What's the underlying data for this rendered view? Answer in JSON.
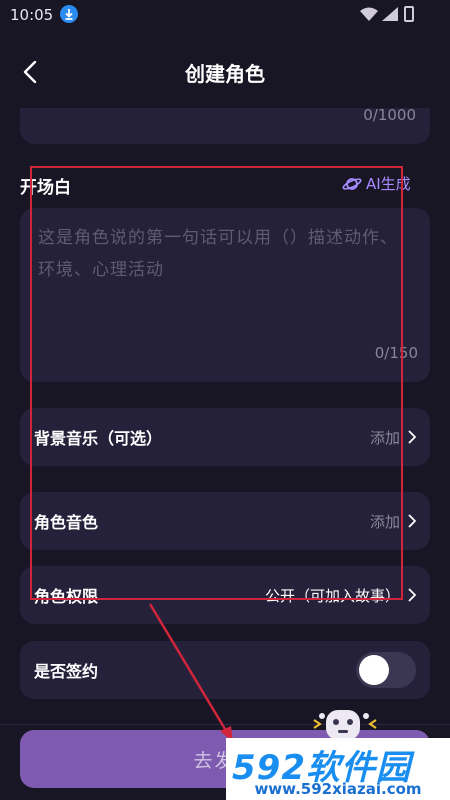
{
  "status_bar": {
    "time": "10:05",
    "icons": [
      "download-icon",
      "wifi-icon",
      "signal-icon",
      "battery-icon"
    ]
  },
  "header": {
    "title": "创建角色",
    "back_icon": "chevron-left-icon"
  },
  "description_card": {
    "counter": "0/1000"
  },
  "opening_line": {
    "label": "开场白",
    "ai_button": "AI生成",
    "ai_icon": "planet-icon",
    "placeholder": "这是角色说的第一句话可以用（）描述动作、环境、心理活动",
    "counter": "0/150"
  },
  "rows": {
    "music": {
      "label": "背景音乐（可选）",
      "value": "添加"
    },
    "voice": {
      "label": "角色音色",
      "value": "添加"
    },
    "permission": {
      "label": "角色权限",
      "value": "公开（可加入故事）"
    },
    "contract": {
      "label": "是否签约",
      "toggle_on": false
    }
  },
  "submit": {
    "label": "去发布"
  },
  "watermark": {
    "logo_num": "592",
    "logo_cn": "软件园",
    "url": "www.592xiazai.com"
  },
  "colors": {
    "background": "#181524",
    "card": "#25213a",
    "accent": "#a68cff",
    "button": "#7e5bb0",
    "annotation": "#d0253a"
  }
}
